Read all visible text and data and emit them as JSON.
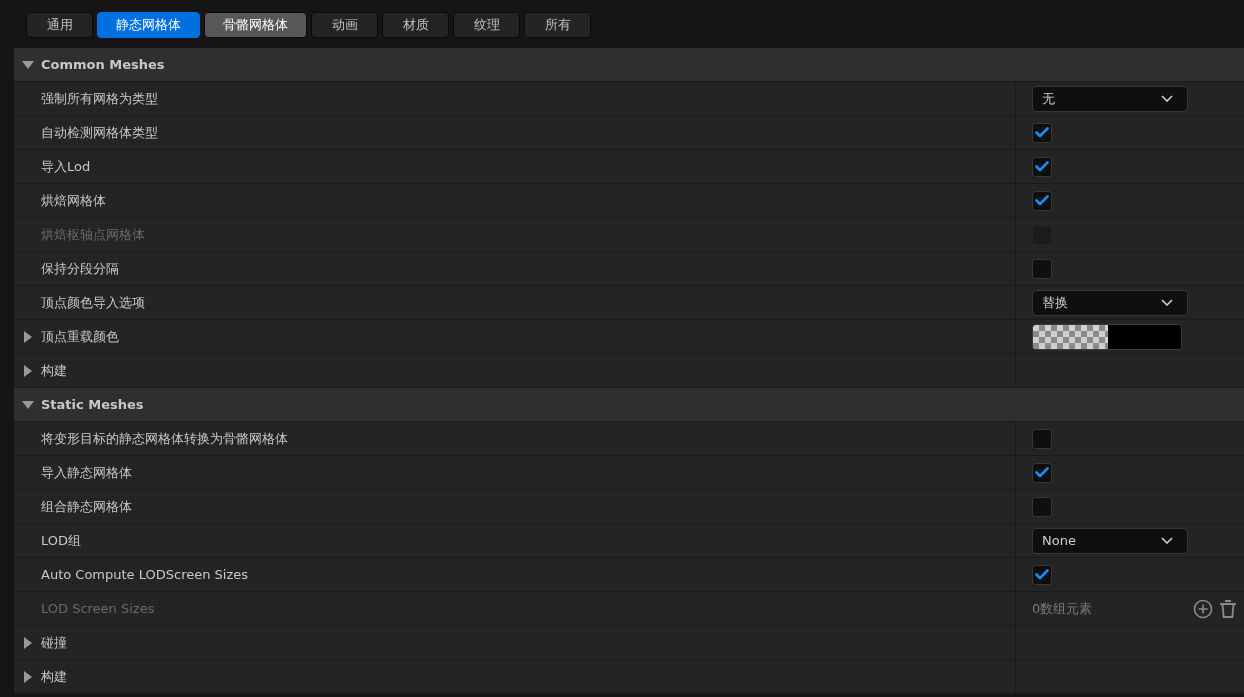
{
  "tabs": [
    {
      "label": "通用",
      "selected": false,
      "hovered": false
    },
    {
      "label": "静态网格体",
      "selected": true,
      "hovered": false
    },
    {
      "label": "骨骼网格体",
      "selected": false,
      "hovered": true
    },
    {
      "label": "动画",
      "selected": false,
      "hovered": false
    },
    {
      "label": "材质",
      "selected": false,
      "hovered": false
    },
    {
      "label": "纹理",
      "selected": false,
      "hovered": false
    },
    {
      "label": "所有",
      "selected": false,
      "hovered": false
    }
  ],
  "sections": [
    {
      "title": "Common Meshes",
      "expanded": true,
      "rows": [
        {
          "label": "强制所有网格为类型",
          "kind": "dropdown",
          "value": "无",
          "disabled": false
        },
        {
          "label": "自动检测网格体类型",
          "kind": "checkbox",
          "checked": true,
          "disabled": false
        },
        {
          "label": "导入Lod",
          "kind": "checkbox",
          "checked": true,
          "disabled": false
        },
        {
          "label": "烘焙网格体",
          "kind": "checkbox",
          "checked": true,
          "disabled": false
        },
        {
          "label": "烘焙枢轴点网格体",
          "kind": "checkbox",
          "checked": false,
          "disabled": true
        },
        {
          "label": "保持分段分隔",
          "kind": "checkbox",
          "checked": false,
          "disabled": false
        },
        {
          "label": "顶点颜色导入选项",
          "kind": "dropdown",
          "value": "替换",
          "disabled": false
        },
        {
          "label": "顶点重载颜色",
          "kind": "color",
          "expanded": false,
          "disabled": false
        },
        {
          "label": "构建",
          "kind": "group",
          "expanded": false,
          "disabled": false
        }
      ]
    },
    {
      "title": "Static Meshes",
      "expanded": true,
      "rows": [
        {
          "label": "将变形目标的静态网格体转换为骨骼网格体",
          "kind": "checkbox",
          "checked": false,
          "disabled": false
        },
        {
          "label": "导入静态网格体",
          "kind": "checkbox",
          "checked": true,
          "disabled": false
        },
        {
          "label": "组合静态网格体",
          "kind": "checkbox",
          "checked": false,
          "disabled": false
        },
        {
          "label": "LOD组",
          "kind": "dropdown",
          "value": "None",
          "disabled": false
        },
        {
          "label": "Auto Compute LODScreen Sizes",
          "kind": "checkbox",
          "checked": true,
          "disabled": false
        },
        {
          "label": "LOD Screen Sizes",
          "kind": "array",
          "value": "0数组元素",
          "disabled": true
        },
        {
          "label": "碰撞",
          "kind": "group",
          "expanded": false,
          "disabled": false
        },
        {
          "label": "构建",
          "kind": "group",
          "expanded": false,
          "disabled": false
        }
      ]
    }
  ]
}
